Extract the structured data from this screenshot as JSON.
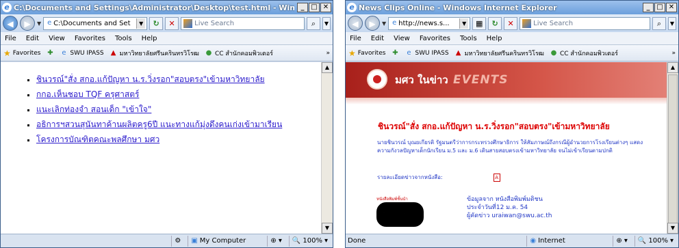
{
  "window1": {
    "title": "C:\\Documents and Settings\\Administrator\\Desktop\\test.html - Windows Intern...",
    "address": "C:\\Documents and Set",
    "search_placeholder": "Live Search",
    "menu": [
      "File",
      "Edit",
      "View",
      "Favorites",
      "Tools",
      "Help"
    ],
    "favorites_label": "Favorites",
    "fav_items": [
      "SWU IPASS",
      "มหาวิทยาลัยศรีนครินทรวิโรฒ",
      "CC สำนักคอมพิวเตอร์"
    ],
    "links": [
      "ชินวรณ์\"สั่ง สกอ.แก้ปัญหา น.ร.วิ่งรอก\"สอบตรง\"เข้ามหาวิทยาลัย",
      "กกอ.เห็นชอบ TQF ครุศาสตร์",
      "แนะเลิกท่องจำ สอนเด็ก \"เข้าใจ\"",
      "อธิการฯสวนสุนันทาค้านผลิตครู6ปี แนะทางแก้มุ่งดึงคนเก่งเข้ามาเรียน",
      "โครงการบัณฑิตคณะพลศึกษา มศว"
    ],
    "status_zone": "My Computer",
    "zoom": "100%"
  },
  "window2": {
    "title": "News Clips Online - Windows Internet Explorer",
    "address": "http://news.s...",
    "search_placeholder": "Live Search",
    "menu": [
      "File",
      "Edit",
      "View",
      "Favorites",
      "Tools",
      "Help"
    ],
    "favorites_label": "Favorites",
    "fav_items": [
      "SWU IPASS",
      "มหาวิทยาลัยศรีนครินทรวิโรฒ",
      "CC สำนักคอมพิวเตอร์"
    ],
    "banner_title": "มศว ในข่าว",
    "banner_events": "EVENTS",
    "headline": "ชินวรณ์\"สั่ง สกอ.แก้ปัญหา น.ร.วิ่งรอก\"สอบตรง\"เข้ามหาวิทยาลัย",
    "paragraph": "นายชินวรณ์ บุณยเกียรติ รัฐมนตรีว่าการกระทรวงศึกษาธิการ ให้สัมภาษณ์ถึงกรณีผู้อำนวยการโรงเรียนต่างๆ แสดงความกังวลปัญหาเด็กนักเรียน ม.5 และ ม.6 เดินสายสอบตรงเข้ามหาวิทยาลัย จนไม่เข้าเรียนตามปกติ",
    "detail_label": "รายละเอียดข่าวจากหนังสือ:",
    "paper_tag": "หนังสือพิมพ์ชั้นนำ",
    "paper_name": "มติชน",
    "source_line1": "ข้อมูลจาก หนังสือพิมพ์มติชน",
    "source_line2": "ประจำวันที่12 ม.ค. 54",
    "source_line3": "ผู้คัดข่าว uraiwan@swu.ac.th",
    "status_left": "Done",
    "status_zone": "Internet",
    "zoom": "100%"
  }
}
